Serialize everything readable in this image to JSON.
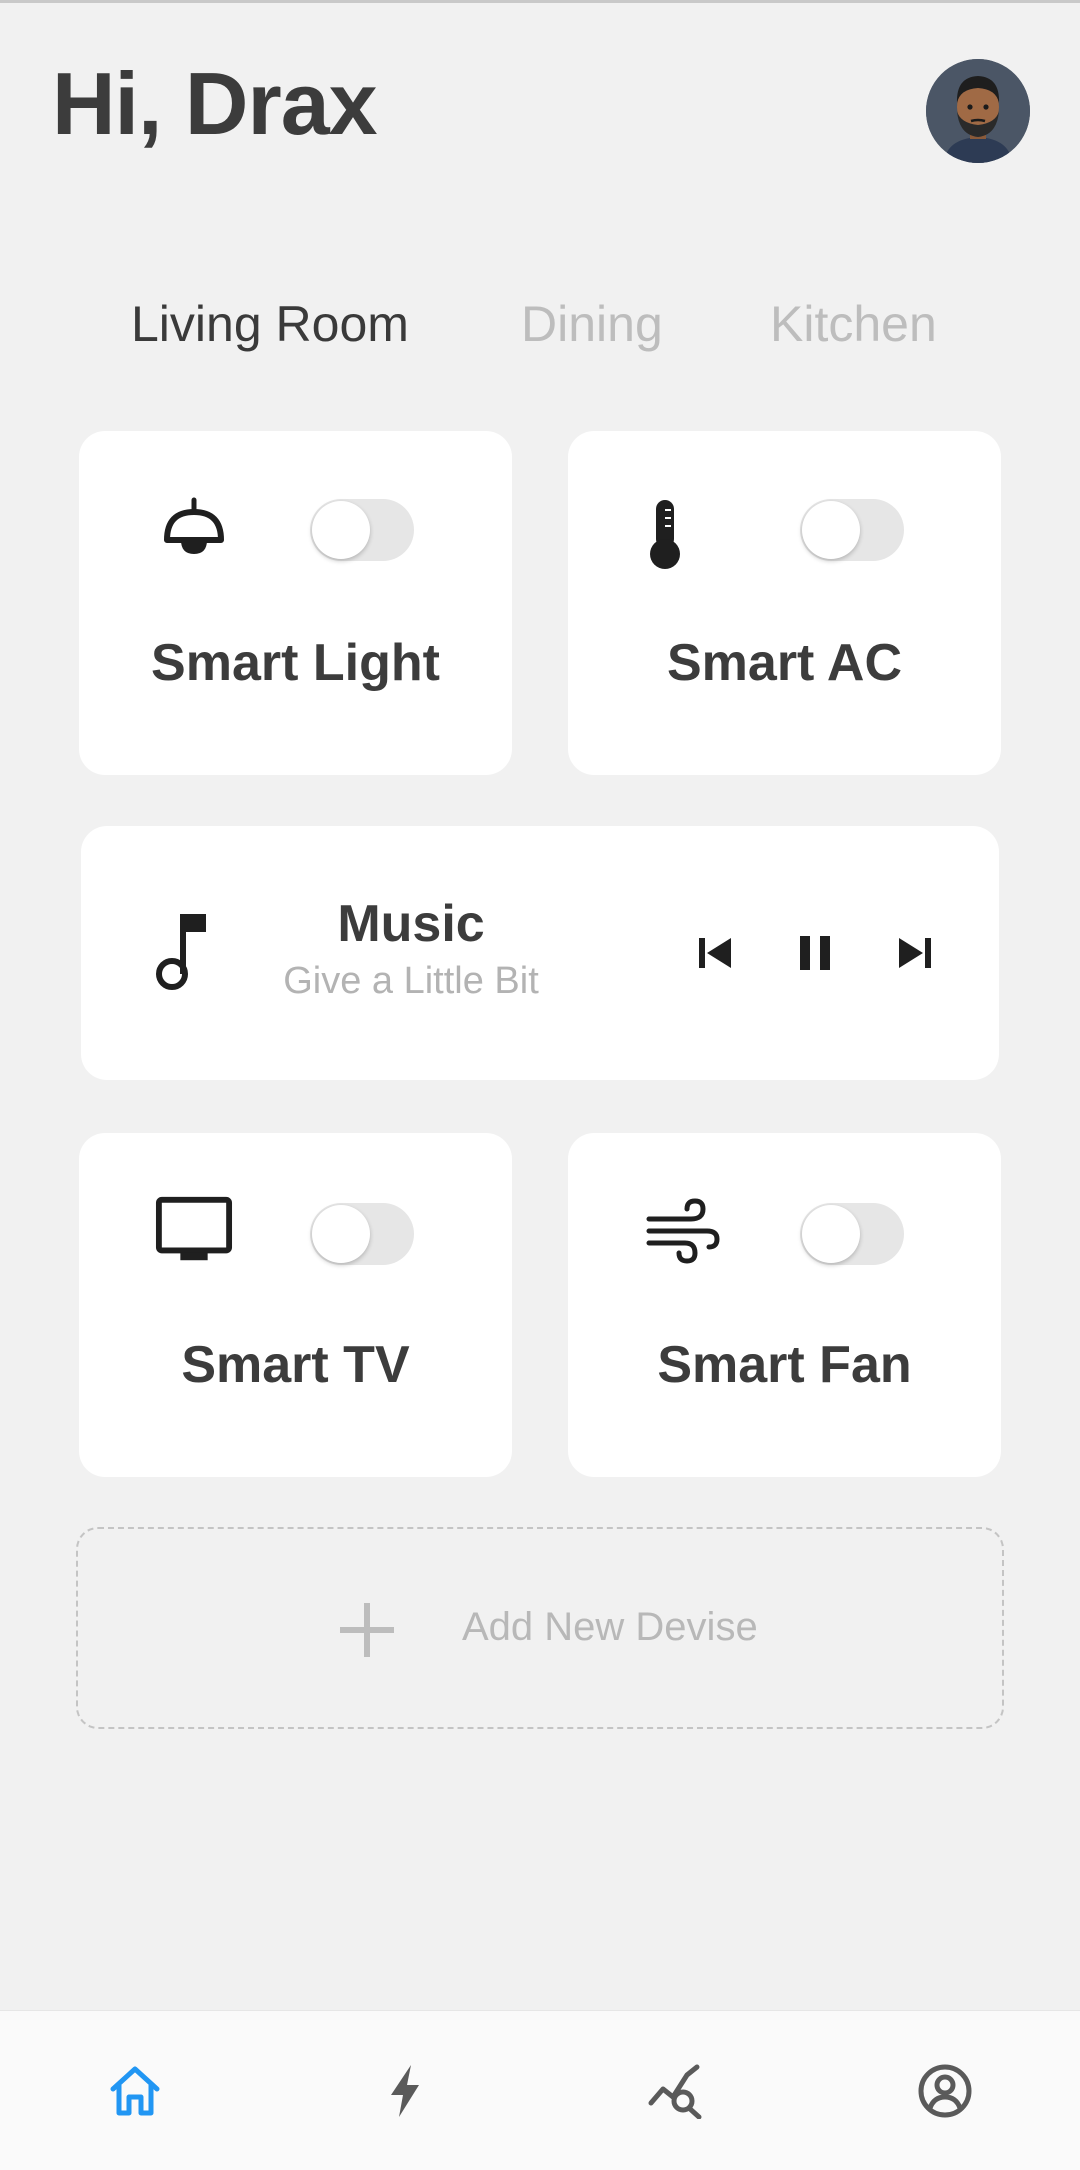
{
  "header": {
    "greeting": "Hi, Drax",
    "avatar_icon": "user-avatar"
  },
  "tabs": [
    {
      "label": "Living Room",
      "active": true
    },
    {
      "label": "Dining",
      "active": false
    },
    {
      "label": "Kitchen",
      "active": false
    }
  ],
  "devices": [
    {
      "name": "Smart Light",
      "icon": "lamp-icon",
      "on": false
    },
    {
      "name": "Smart AC",
      "icon": "thermometer-icon",
      "on": false
    },
    {
      "name": "Smart TV",
      "icon": "tv-icon",
      "on": false
    },
    {
      "name": "Smart Fan",
      "icon": "wind-icon",
      "on": false
    }
  ],
  "music": {
    "title": "Music",
    "track": "Give a Little Bit",
    "icon": "music-note-icon",
    "controls": [
      "skip-previous-icon",
      "pause-icon",
      "skip-next-icon"
    ]
  },
  "add_device": {
    "label": "Add New Devise",
    "icon": "plus-icon"
  },
  "bottom_nav": {
    "items": [
      "home-icon",
      "bolt-icon",
      "analytics-icon",
      "profile-icon"
    ],
    "active": "home-icon"
  },
  "colors": {
    "background": "#f1f1f1",
    "card": "#ffffff",
    "accent": "#2196f3",
    "text_dark": "#3c3c3c",
    "text_muted": "#bdbdbd"
  }
}
